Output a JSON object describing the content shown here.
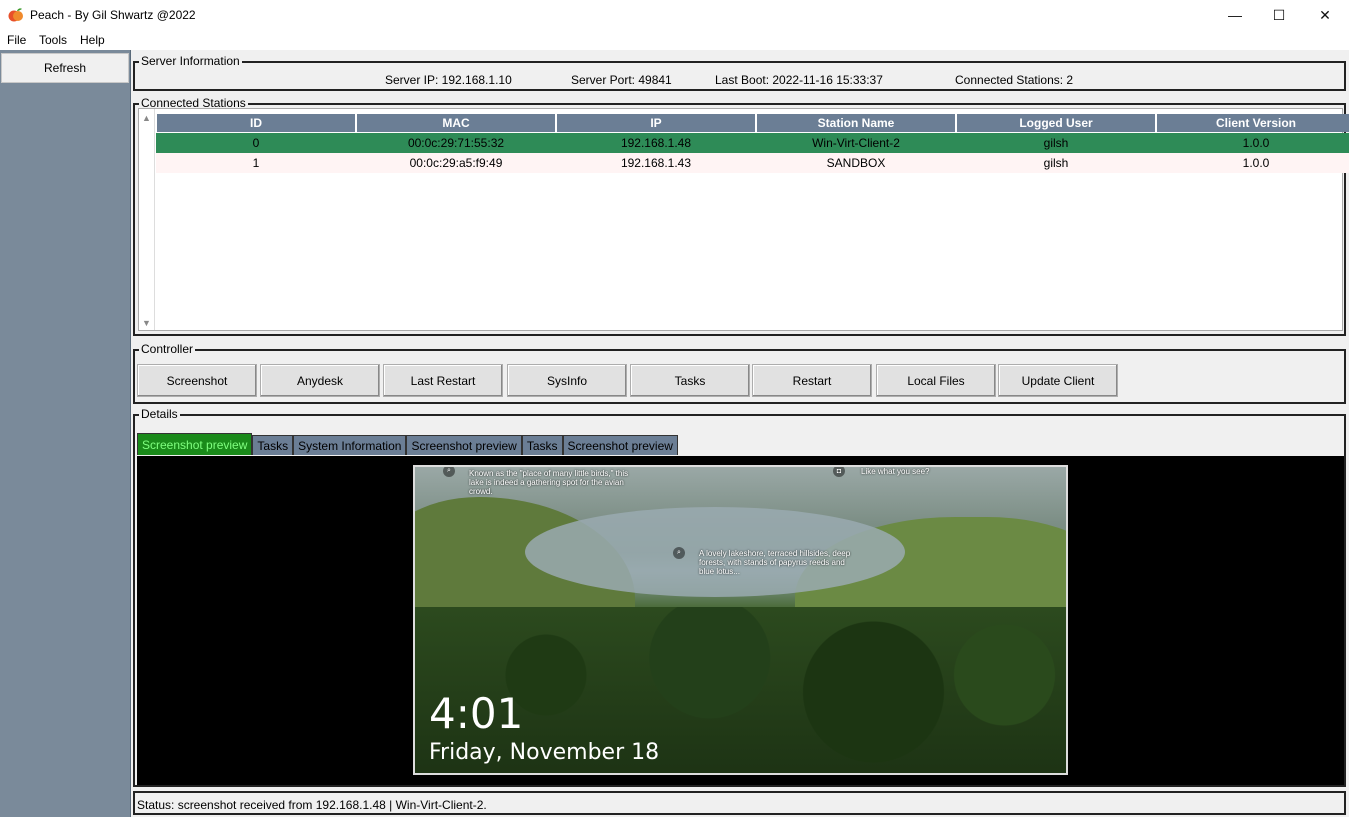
{
  "window": {
    "title": "Peach - By Gil Shwartz @2022",
    "min_glyph": "—",
    "max_glyph": "☐",
    "close_glyph": "✕"
  },
  "menu": [
    "File",
    "Tools",
    "Help"
  ],
  "sidebar": {
    "refresh_label": "Refresh"
  },
  "server_info": {
    "legend": "Server Information",
    "ip": "Server IP: 192.168.1.10",
    "port": "Server Port: 49841",
    "boot": "Last Boot: 2022-11-16 15:33:37",
    "stations": "Connected Stations: 2"
  },
  "stations": {
    "legend": "Connected Stations",
    "columns": [
      "ID",
      "MAC",
      "IP",
      "Station Name",
      "Logged User",
      "Client Version"
    ],
    "rows": [
      [
        "0",
        "00:0c:29:71:55:32",
        "192.168.1.48",
        "Win-Virt-Client-2",
        "gilsh",
        "1.0.0"
      ],
      [
        "1",
        "00:0c:29:a5:f9:49",
        "192.168.1.43",
        "SANDBOX",
        "gilsh",
        "1.0.0"
      ]
    ],
    "selected_row": 0,
    "selected_color": "#2e8b57"
  },
  "controller": {
    "legend": "Controller",
    "buttons": [
      "Screenshot",
      "Anydesk",
      "Last Restart",
      "SysInfo",
      "Tasks",
      "Restart",
      "Local Files",
      "Update Client"
    ]
  },
  "details": {
    "legend": "Details",
    "tabs": [
      "Screenshot preview",
      "Tasks",
      "System Information",
      "Screenshot preview",
      "Tasks",
      "Screenshot preview"
    ],
    "active_tab": 0,
    "preview": {
      "caption_top_left": "Known as the \"place of many little birds,\" this lake is indeed a gathering spot for the avian crowd.",
      "caption_top_right": "Like what you see?",
      "caption_middle": "A lovely lakeshore, terraced hillsides, deep forests, with stands of papyrus reeds and blue lotus...",
      "time": "4:01",
      "date": "Friday, November 18"
    }
  },
  "status": {
    "text": "Status: screenshot received from  192.168.1.48 | Win-Virt-Client-2."
  }
}
